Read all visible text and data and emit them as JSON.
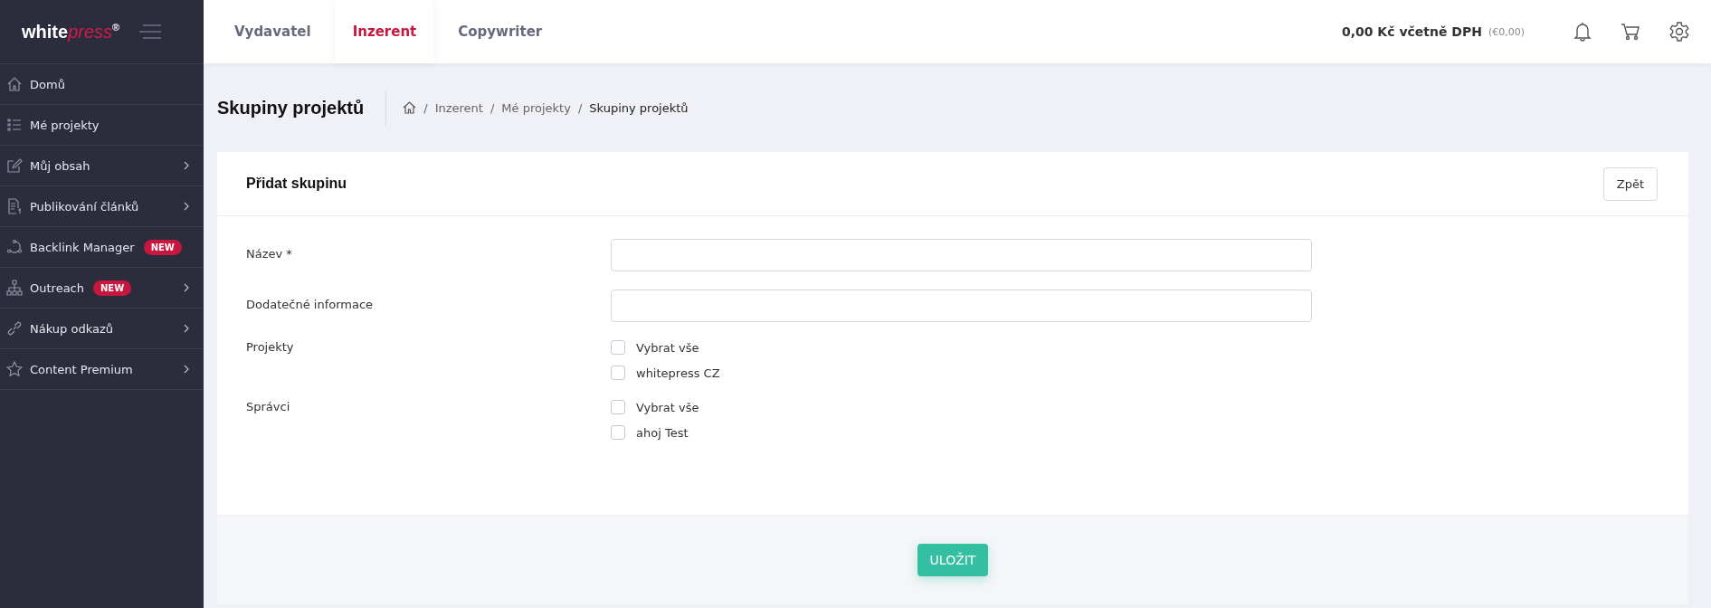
{
  "logo": {
    "part_1": "white",
    "part_2": "press",
    "mark": "®"
  },
  "top_tabs": [
    {
      "label": "Vydavatel",
      "selected": false
    },
    {
      "label": "Inzerent",
      "selected": true
    },
    {
      "label": "Copywriter",
      "selected": false
    }
  ],
  "balance": {
    "amount": "0,00 Kč včetně DPH",
    "euro": "(€0,00)"
  },
  "sidebar": {
    "items": [
      {
        "label": "Domů",
        "has_submenu": false
      },
      {
        "label": "Mé projekty",
        "has_submenu": false
      },
      {
        "label": "Můj obsah",
        "has_submenu": true
      },
      {
        "label": "Publikování článků",
        "has_submenu": true
      },
      {
        "label": "Backlink Manager",
        "badge": "NEW",
        "has_submenu": false
      },
      {
        "label": "Outreach",
        "badge": "NEW",
        "has_submenu": true
      },
      {
        "label": "Nákup odkazů",
        "has_submenu": true
      },
      {
        "label": "Content Premium",
        "has_submenu": true
      }
    ]
  },
  "page_title": "Skupiny projektů",
  "breadcrumb": [
    {
      "separator": "/",
      "label": "Inzerent"
    },
    {
      "separator": "/",
      "label": "Mé projekty"
    },
    {
      "separator": "/",
      "label": "Skupiny projektů"
    }
  ],
  "card": {
    "title": "Přidat skupinu",
    "back_button": "Zpět",
    "fields": [
      {
        "label": "Název *",
        "kind": "text"
      },
      {
        "label": "Dodatečné informace",
        "kind": "text"
      },
      {
        "label": "Projekty",
        "kind": "checkboxes",
        "options": [
          {
            "label": "Vybrat vše",
            "checked": false
          },
          {
            "label": "whitepress CZ",
            "checked": false
          }
        ]
      },
      {
        "label": "Správci",
        "kind": "checkboxes",
        "options": [
          {
            "label": "Vybrat vše",
            "checked": false
          },
          {
            "label": "ahoj Test",
            "checked": false
          }
        ]
      }
    ],
    "save_button": "ULOŽIT"
  }
}
